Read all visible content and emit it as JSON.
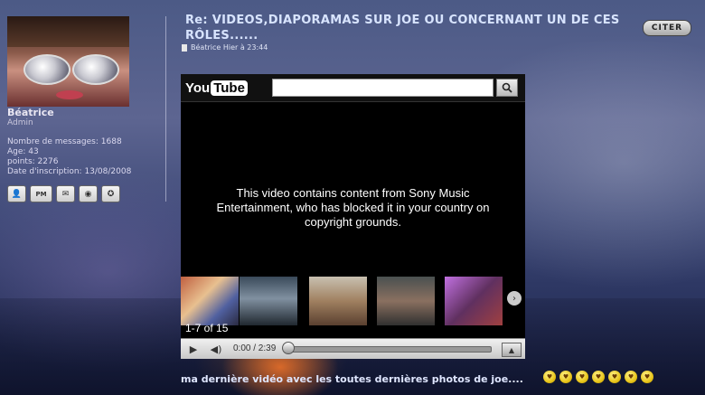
{
  "user": {
    "name": "Béatrice",
    "role": "Admin",
    "stats": [
      "Nombre de messages: 1688",
      "Age: 43",
      "points: 2276",
      "Date d'inscription: 13/08/2008"
    ],
    "buttons": [
      {
        "name": "profile-icon",
        "glyph": "👤"
      },
      {
        "name": "pm-icon",
        "glyph": "PM"
      },
      {
        "name": "email-icon",
        "glyph": "✉"
      },
      {
        "name": "website-icon",
        "glyph": "◉"
      },
      {
        "name": "skype-icon",
        "glyph": "✪"
      }
    ]
  },
  "post": {
    "title": "Re: VIDEOS,DIAPORAMAS SUR JOE OU CONCERNANT UN DE CES RÔLES......",
    "meta": "Béatrice Hier à 23:44",
    "quote_label": "CITER",
    "caption": "ma dernière vidéo avec les toutes dernières photos de joe....",
    "smiley_count": 7
  },
  "youtube": {
    "logo_you": "You",
    "logo_tube": "Tube",
    "blocked_message": "This video contains content from Sony Music Entertainment, who has blocked it in your country on copyright grounds.",
    "thumb_count": "1-7 of 15",
    "time": "0:00 / 2:39",
    "progress": 0
  },
  "colors": {
    "title": "#d8e4ff",
    "player_bg": "#000000"
  }
}
